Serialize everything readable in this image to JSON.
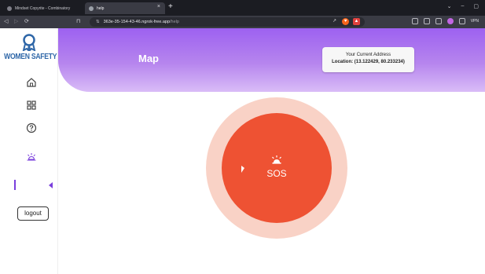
{
  "browser": {
    "tabs": [
      {
        "label": "Mindset Copyrite - Combinatory",
        "active": false
      },
      {
        "label": "help",
        "active": true
      }
    ],
    "new_tab": "+",
    "close_tab": "×",
    "window_controls": [
      "⌄",
      "–",
      "▢"
    ],
    "url_host": "363e-35-154-43-46.ngrok-free.app",
    "url_path": "/help",
    "vpn_label": "VPN"
  },
  "sidebar": {
    "logo_text": "WOMEN SAFETY",
    "items": [
      {
        "icon": "home-icon"
      },
      {
        "icon": "grid-icon"
      },
      {
        "icon": "help-icon"
      },
      {
        "icon": "sun-icon",
        "active": true
      }
    ],
    "logout_label": "logout"
  },
  "header": {
    "title": "Map",
    "address_card": {
      "title": "Your Current Address",
      "location": "Location: (13.122429, 80.233234)"
    }
  },
  "sos": {
    "label": "SOS",
    "icon": "alarm-icon"
  },
  "colors": {
    "accent": "#9d61f0",
    "sos": "#ee5233",
    "sos_halo": "#f9d2c6",
    "logo": "#2f67a8"
  }
}
